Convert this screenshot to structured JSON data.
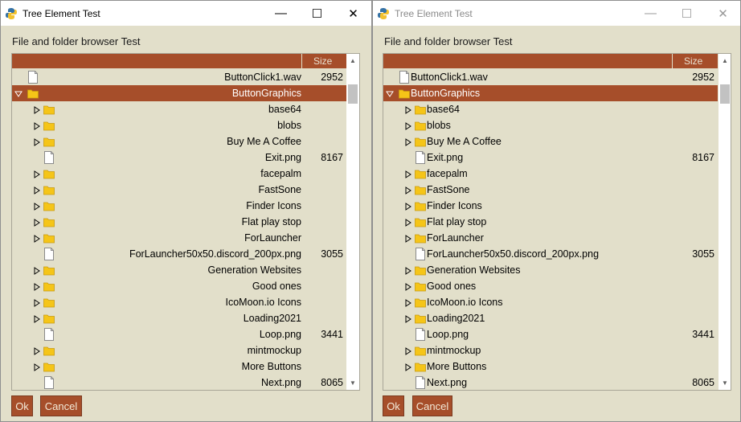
{
  "windows": [
    {
      "title": "Tree Element Test",
      "label": "File and folder browser Test",
      "size_header": "Size",
      "ok_label": "Ok",
      "cancel_label": "Cancel",
      "align": "right",
      "active": true
    },
    {
      "title": "Tree Element Test",
      "label": "File and folder browser Test",
      "size_header": "Size",
      "ok_label": "Ok",
      "cancel_label": "Cancel",
      "align": "left",
      "active": false
    }
  ],
  "window_controls": {
    "minimize": "—",
    "maximize": "☐",
    "close": "✕"
  },
  "scroll_arrows": {
    "up": "▲",
    "down": "▼"
  },
  "rows": [
    {
      "name": "ButtonClick1.wav",
      "size": "2952",
      "type": "file",
      "level": 0
    },
    {
      "name": "ButtonGraphics",
      "size": "",
      "type": "folder",
      "level": 0,
      "expanded": true,
      "selected": true
    },
    {
      "name": "base64",
      "size": "",
      "type": "folder",
      "level": 1
    },
    {
      "name": "blobs",
      "size": "",
      "type": "folder",
      "level": 1
    },
    {
      "name": "Buy Me A Coffee",
      "size": "",
      "type": "folder",
      "level": 1
    },
    {
      "name": "Exit.png",
      "size": "8167",
      "type": "file",
      "level": 1
    },
    {
      "name": "facepalm",
      "size": "",
      "type": "folder",
      "level": 1
    },
    {
      "name": "FastSone",
      "size": "",
      "type": "folder",
      "level": 1
    },
    {
      "name": "Finder Icons",
      "size": "",
      "type": "folder",
      "level": 1
    },
    {
      "name": "Flat play stop",
      "size": "",
      "type": "folder",
      "level": 1
    },
    {
      "name": "ForLauncher",
      "size": "",
      "type": "folder",
      "level": 1
    },
    {
      "name": "ForLauncher50x50.discord_200px.png",
      "size": "3055",
      "type": "file",
      "level": 1
    },
    {
      "name": "Generation Websites",
      "size": "",
      "type": "folder",
      "level": 1
    },
    {
      "name": "Good ones",
      "size": "",
      "type": "folder",
      "level": 1
    },
    {
      "name": "IcoMoon.io Icons",
      "size": "",
      "type": "folder",
      "level": 1
    },
    {
      "name": "Loading2021",
      "size": "",
      "type": "folder",
      "level": 1
    },
    {
      "name": "Loop.png",
      "size": "3441",
      "type": "file",
      "level": 1
    },
    {
      "name": "mintmockup",
      "size": "",
      "type": "folder",
      "level": 1
    },
    {
      "name": "More Buttons",
      "size": "",
      "type": "folder",
      "level": 1
    },
    {
      "name": "Next.png",
      "size": "8065",
      "type": "file",
      "level": 1
    }
  ],
  "colors": {
    "accent": "#a64e2a",
    "background": "#e2dfca",
    "folder": "#f5c518"
  }
}
